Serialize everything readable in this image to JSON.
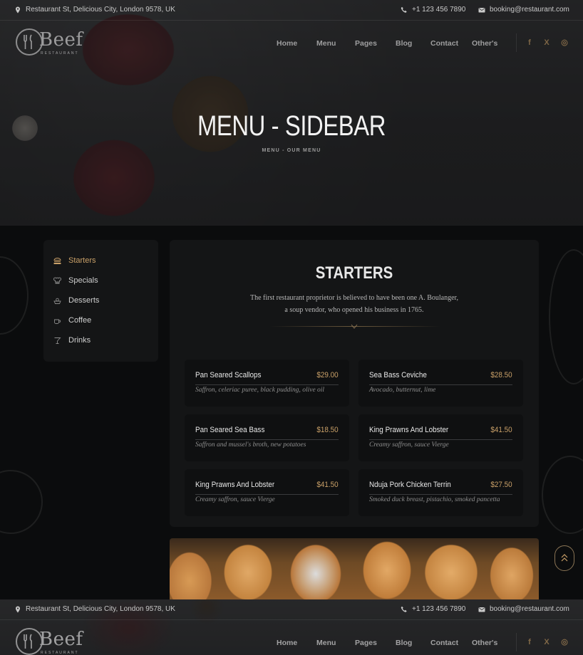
{
  "topbar": {
    "address": "Restaurant St, Delicious City, London 9578, UK",
    "phone": "+1 123 456 7890",
    "email": "booking@restaurant.com"
  },
  "brand": {
    "name": "Beef",
    "tagline": "RESTAURANT"
  },
  "nav": [
    "Home",
    "Menu",
    "Pages",
    "Blog",
    "Contact",
    "Other's"
  ],
  "social": [
    "f",
    "X",
    "◎"
  ],
  "hero": {
    "title": "MENU - SIDEBAR",
    "breadcrumb": "MENU - OUR MENU"
  },
  "sidebar": {
    "items": [
      {
        "label": "Starters",
        "icon": "burger-icon",
        "active": true
      },
      {
        "label": "Specials",
        "icon": "chef-hat-icon",
        "active": false
      },
      {
        "label": "Desserts",
        "icon": "dessert-icon",
        "active": false
      },
      {
        "label": "Coffee",
        "icon": "coffee-cup-icon",
        "active": false
      },
      {
        "label": "Drinks",
        "icon": "cocktail-glass-icon",
        "active": false
      }
    ]
  },
  "section": {
    "title": "STARTERS",
    "desc_line1": "The first restaurant proprietor is believed to have been one A. Boulanger,",
    "desc_line2": "a soup vendor, who opened his business in 1765."
  },
  "menu_items": [
    {
      "name": "Pan Seared Scallops",
      "price": "$29.00",
      "desc": "Saffron, celeriac puree, black pudding, olive oil"
    },
    {
      "name": "Sea Bass Ceviche",
      "price": "$28.50",
      "desc": "Avocado, butternut, lime"
    },
    {
      "name": "Pan Seared Sea Bass",
      "price": "$18.50",
      "desc": "Saffron and mussel's broth, new potatoes"
    },
    {
      "name": "King Prawns And Lobster",
      "price": "$41.50",
      "desc": "Creamy saffron, sauce Vierge"
    },
    {
      "name": "King Prawns And Lobster",
      "price": "$41.50",
      "desc": "Creamy saffron, sauce Vierge"
    },
    {
      "name": "Nduja Pork Chicken Terrin",
      "price": "$27.50",
      "desc": "Smoked duck breast, pistachio, smoked pancetta"
    }
  ],
  "colors": {
    "accent": "#c9a068",
    "background": "#0b0c0d",
    "panel": "#141516",
    "card": "#0f1011"
  }
}
